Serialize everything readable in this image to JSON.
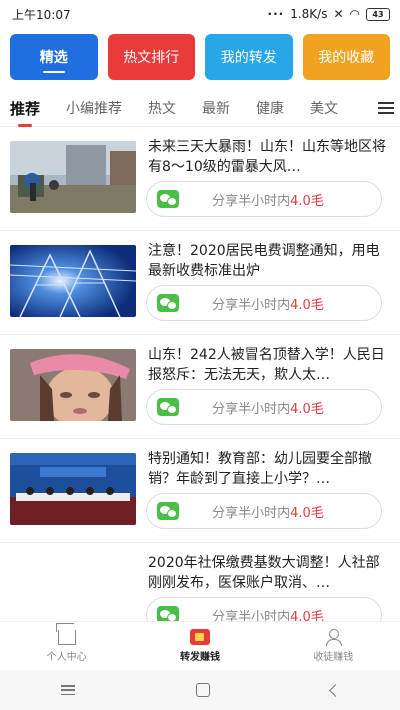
{
  "status_bar": {
    "time": "上午10:07",
    "dots": "···",
    "net_speed": "1.8K/s",
    "battery": "43"
  },
  "quick_buttons": [
    {
      "label": "精选",
      "color": "#1f6fe0"
    },
    {
      "label": "热文排行",
      "color": "#ea3b3b"
    },
    {
      "label": "我的转发",
      "color": "#27a7e8"
    },
    {
      "label": "我的收藏",
      "color": "#f1a320"
    }
  ],
  "tabs": [
    "推荐",
    "小编推荐",
    "热文",
    "最新",
    "健康",
    "美文"
  ],
  "articles": [
    {
      "title": "未来三天大暴雨！山东！山东等地区将有8～10级的雷暴大风…",
      "share_prefix": "分享半小时内",
      "share_amount": "4.0毛",
      "thumb": "flood-street-image"
    },
    {
      "title": "注意！2020居民电费调整通知，用电最新收费标准出炉",
      "share_prefix": "分享半小时内",
      "share_amount": "4.0毛",
      "thumb": "power-tower-image"
    },
    {
      "title": "山东！242人被冒名顶替入学！人民日报怒斥：无法无天，欺人太…",
      "share_prefix": "分享半小时内",
      "share_amount": "4.0毛",
      "thumb": "crying-girl-image"
    },
    {
      "title": "特别通知！教育部：幼儿园要全部撤销？年龄到了直接上小学？…",
      "share_prefix": "分享半小时内",
      "share_amount": "4.0毛",
      "thumb": "press-conference-image"
    },
    {
      "title": "2020年社保缴费基数大调整！人社部刚刚发布，医保账户取消、…",
      "share_prefix": "分享半小时内",
      "share_amount": "4.0毛",
      "thumb": ""
    }
  ],
  "bottom_nav": [
    {
      "label": "个人中心"
    },
    {
      "label": "转发赚钱"
    },
    {
      "label": "收徒赚钱"
    }
  ]
}
